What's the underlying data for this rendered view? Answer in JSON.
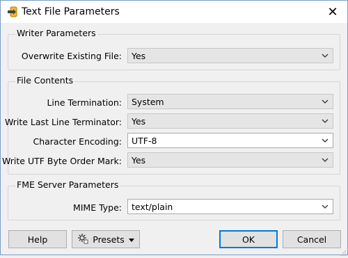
{
  "window": {
    "title": "Text File Parameters",
    "close_glyph": "✕",
    "icon": "text-file-icon"
  },
  "groups": {
    "writer": {
      "title": "Writer Parameters",
      "rows": [
        {
          "label": "Overwrite Existing File:",
          "value": "Yes"
        }
      ]
    },
    "contents": {
      "title": "File Contents",
      "rows": [
        {
          "label": "Line Termination:",
          "value": "System"
        },
        {
          "label": "Write Last Line Terminator:",
          "value": "Yes"
        },
        {
          "label": "Character Encoding:",
          "value": "UTF-8"
        },
        {
          "label": "Write UTF Byte Order Mark:",
          "value": "Yes"
        }
      ]
    },
    "server": {
      "title": "FME Server Parameters",
      "rows": [
        {
          "label": "MIME Type:",
          "value": "text/plain"
        }
      ]
    }
  },
  "buttons": {
    "help": "Help",
    "presets": "Presets",
    "ok": "OK",
    "cancel": "Cancel"
  }
}
